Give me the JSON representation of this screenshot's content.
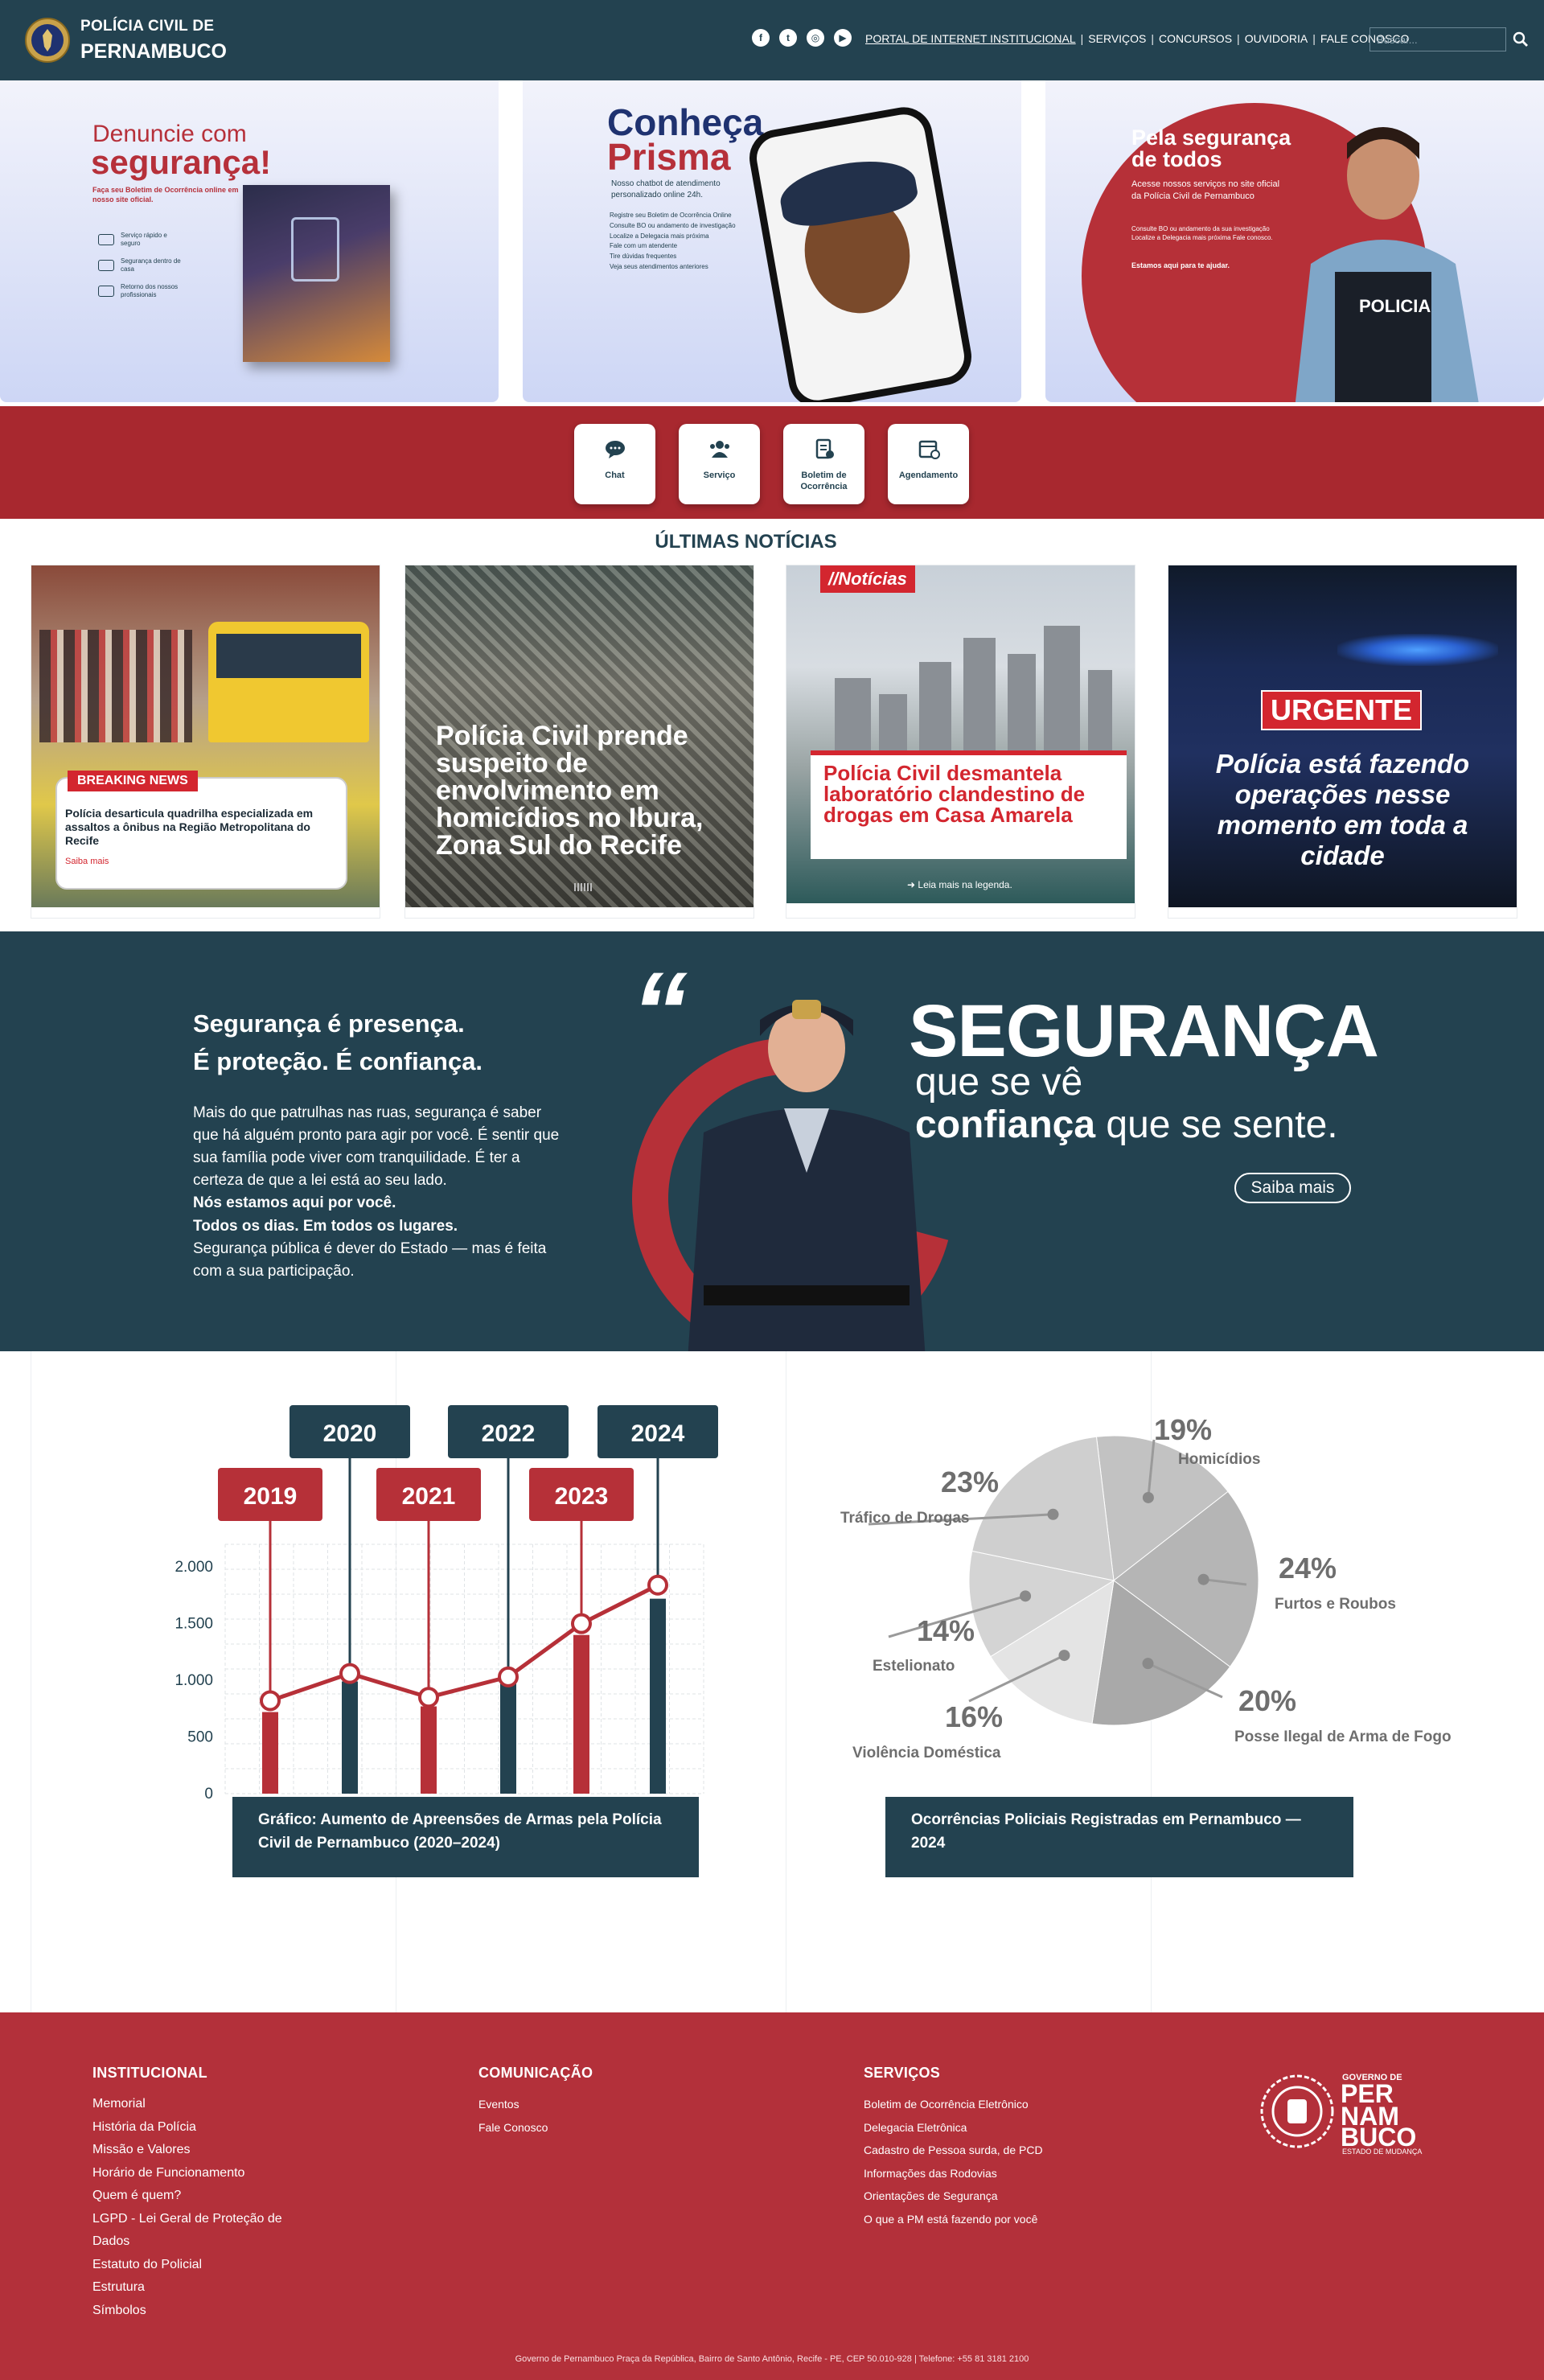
{
  "header": {
    "title_line1": "POLÍCIA CIVIL DE",
    "title_line2": "PERNAMBUCO",
    "socials": [
      "facebook-icon",
      "twitter-icon",
      "instagram-icon",
      "youtube-icon"
    ],
    "nav": [
      "PORTAL DE INTERNET INSTITUCIONAL",
      "SERVIÇOS",
      "CONCURSOS",
      "OUVIDORIA",
      "FALE CONOSCO"
    ],
    "search_placeholder": "Buscar..."
  },
  "banners": {
    "denuncie": {
      "line1": "Denuncie com",
      "line2": "segurança!",
      "sub": "Faça seu Boletim de Ocorrência online em nosso site oficial.",
      "features": [
        "Serviço rápido e seguro",
        "Segurança dentro de casa",
        "Retorno dos nossos profissionais"
      ]
    },
    "prisma": {
      "line1": "Conheça",
      "line2": "Prisma",
      "sub": "Nosso chatbot de atendimento personalizado online 24h.",
      "list": [
        "Registre seu Boletim de Ocorrência Online",
        "Consulte BO ou andamento de investigação",
        "Localize a Delegacia mais próxima",
        "Fale com um atendente",
        "Tire dúvidas frequentes",
        "Veja seus atendimentos anteriores"
      ]
    },
    "seguranca": {
      "title": "Pela segurança de todos",
      "sub": "Acesse nossos serviços no site oficial da Polícia Civil de Pernambuco",
      "sub2": "Consulte BO ou andamento da sua investigação Localize a Delegacia mais próxima Fale conosco.",
      "sub3": "Estamos aqui para te ajudar.",
      "vest": "POLICIA"
    }
  },
  "actions": [
    {
      "label": "Chat",
      "icon": "chat-icon"
    },
    {
      "label": "Serviço",
      "icon": "people-icon"
    },
    {
      "label": "Boletim de Ocorrência",
      "icon": "document-icon"
    },
    {
      "label": "Agendamento",
      "icon": "calendar-icon"
    }
  ],
  "news": {
    "section_title": "ÚLTIMAS NOTÍCIAS",
    "items": [
      {
        "tag": "BREAKING NEWS",
        "headline": "Polícia desarticula quadrilha especializada em assaltos a ônibus na Região Metropolitana do Recife",
        "more": "Saiba mais"
      },
      {
        "headline": "Polícia Civil prende suspeito de envolvimento em homicídios no Ibura, Zona Sul do Recife"
      },
      {
        "tag": "//Notícias",
        "headline": "Polícia Civil desmantela laboratório clandestino de drogas em Casa Amarela",
        "more": "Leia mais na legenda."
      },
      {
        "tag": "URGENTE",
        "headline": "Polícia está fazendo operações nesse momento em toda a cidade"
      }
    ]
  },
  "seguranca_section": {
    "heading_line1": "Segurança é presença.",
    "heading_line2": "É proteção. É confiança.",
    "p1": "Mais do que patrulhas nas ruas, segurança é saber que há alguém pronto para agir por você. É sentir que sua família pode viver com tranquilidade. É ter a certeza de que a lei está ao seu lado.",
    "p2": "Nós estamos aqui por você.",
    "p3": "Todos os dias. Em todos os lugares.",
    "p4": "Segurança pública é dever do Estado — mas é feita com a sua participação.",
    "quote_mark": "“",
    "big": "SEGURANÇA",
    "line2": "que se vê",
    "line3_bold": "confiança",
    "line3_rest": " que se sente.",
    "button": "Saiba mais"
  },
  "chart_data": [
    {
      "type": "bar",
      "caption": "Gráfico: Aumento de Apreensões de Armas pela Polícia Civil de Pernambuco (2020–2024)",
      "categories": [
        "2019",
        "2020",
        "2021",
        "2022",
        "2023",
        "2024"
      ],
      "series": [
        {
          "values": [
            720,
            990,
            770,
            970,
            1400,
            1720
          ],
          "color_alt": [
            "#b63038",
            "#234250",
            "#b63038",
            "#234250",
            "#b63038",
            "#234250"
          ]
        }
      ],
      "line_values": [
        820,
        1060,
        850,
        1030,
        1500,
        1840
      ],
      "yticks": [
        "0",
        "500",
        "1.000",
        "1.500",
        "2.000"
      ],
      "ylim": [
        0,
        2200
      ]
    },
    {
      "type": "pie",
      "caption": "Ocorrências Policiais Registradas em Pernambuco — 2024",
      "slices": [
        {
          "label": "Homicídios",
          "value": 19,
          "text": "19%",
          "color": "#c2c2c2"
        },
        {
          "label": "Furtos e Roubos",
          "value": 24,
          "text": "24%",
          "color": "#b5b5b5"
        },
        {
          "label": "Posse Ilegal de Arma de Fogo",
          "value": 20,
          "text": "20%",
          "color": "#a9a9a9"
        },
        {
          "label": "Violência Doméstica",
          "value": 16,
          "text": "16%",
          "color": "#e4e4e4"
        },
        {
          "label": "Estelionato",
          "value": 14,
          "text": "14%",
          "color": "#d4d4d4"
        },
        {
          "label": "Tráfico de Drogas",
          "value": 23,
          "text": "23%",
          "color": "#cfcfcf"
        }
      ]
    }
  ],
  "footer": {
    "institucional": {
      "title": "INSTITUCIONAL",
      "links": [
        "Memorial",
        "História da Polícia",
        "Missão e Valores",
        "Horário de Funcionamento",
        "Quem é quem?",
        "LGPD - Lei Geral de Proteção de",
        "Dados",
        "Estatuto do Policial",
        "Estrutura",
        "Símbolos"
      ]
    },
    "comunicacao": {
      "title": "COMUNICAÇÃO",
      "links": [
        "Eventos",
        "Fale Conosco"
      ]
    },
    "servicos": {
      "title": "SERVIÇOS",
      "links": [
        "Boletim de Ocorrência Eletrônico",
        "Delegacia Eletrônica",
        "Cadastro de Pessoa surda, de PCD",
        "Informações das Rodovias",
        "Orientações de Segurança",
        "O que a PM está fazendo por você"
      ]
    },
    "gov_logo": {
      "l1": "GOVERNO DE",
      "l2": "PER",
      "l3": "NAM",
      "l4": "BUCO",
      "l5": "ESTADO DE MUDANÇA"
    },
    "address": "Governo de Pernambuco Praça da República, Bairro de Santo Antônio, Recife - PE, CEP 50.010-928 | Telefone: +55 81 3181 2100"
  }
}
